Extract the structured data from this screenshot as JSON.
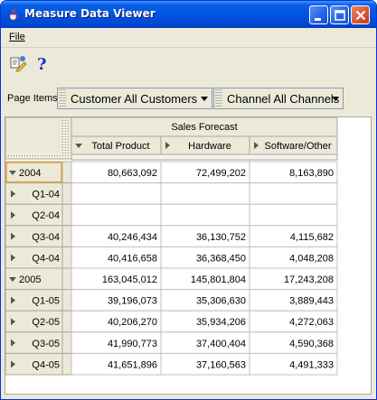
{
  "window": {
    "title": "Measure Data Viewer",
    "icon": "java-cup-icon"
  },
  "menu": {
    "file_label": "File"
  },
  "toolbar": {
    "items": [
      {
        "name": "edit-query-icon"
      },
      {
        "name": "help-icon",
        "glyph": "?"
      }
    ]
  },
  "page_items": {
    "label": "Page Items",
    "customer": "Customer  All Customers",
    "channel": "Channel  All Channels"
  },
  "crosstab": {
    "measure_header": "Sales Forecast",
    "columns": [
      "Total Product",
      "Hardware",
      "Software/Other"
    ],
    "rows": [
      {
        "label": "2004",
        "level": 0,
        "expanded": true,
        "values": [
          "80,663,092",
          "72,499,202",
          "8,163,890"
        ]
      },
      {
        "label": "Q1-04",
        "level": 1,
        "expanded": false,
        "values": [
          "",
          "",
          ""
        ]
      },
      {
        "label": "Q2-04",
        "level": 1,
        "expanded": false,
        "values": [
          "",
          "",
          ""
        ]
      },
      {
        "label": "Q3-04",
        "level": 1,
        "expanded": false,
        "values": [
          "40,246,434",
          "36,130,752",
          "4,115,682"
        ]
      },
      {
        "label": "Q4-04",
        "level": 1,
        "expanded": false,
        "values": [
          "40,416,658",
          "36,368,450",
          "4,048,208"
        ]
      },
      {
        "label": "2005",
        "level": 0,
        "expanded": true,
        "values": [
          "163,045,012",
          "145,801,804",
          "17,243,208"
        ]
      },
      {
        "label": "Q1-05",
        "level": 1,
        "expanded": false,
        "values": [
          "39,196,073",
          "35,306,630",
          "3,889,443"
        ]
      },
      {
        "label": "Q2-05",
        "level": 1,
        "expanded": false,
        "values": [
          "40,206,270",
          "35,934,206",
          "4,272,063"
        ]
      },
      {
        "label": "Q3-05",
        "level": 1,
        "expanded": false,
        "values": [
          "41,990,773",
          "37,400,404",
          "4,590,368"
        ]
      },
      {
        "label": "Q4-05",
        "level": 1,
        "expanded": false,
        "values": [
          "41,651,896",
          "37,160,563",
          "4,491,333"
        ]
      }
    ]
  },
  "colors": {
    "title_bar": "#0054e3",
    "grid_header": "#ece9d8",
    "grid_line": "#c0c0c0",
    "selected_border": "#e8a43c"
  }
}
